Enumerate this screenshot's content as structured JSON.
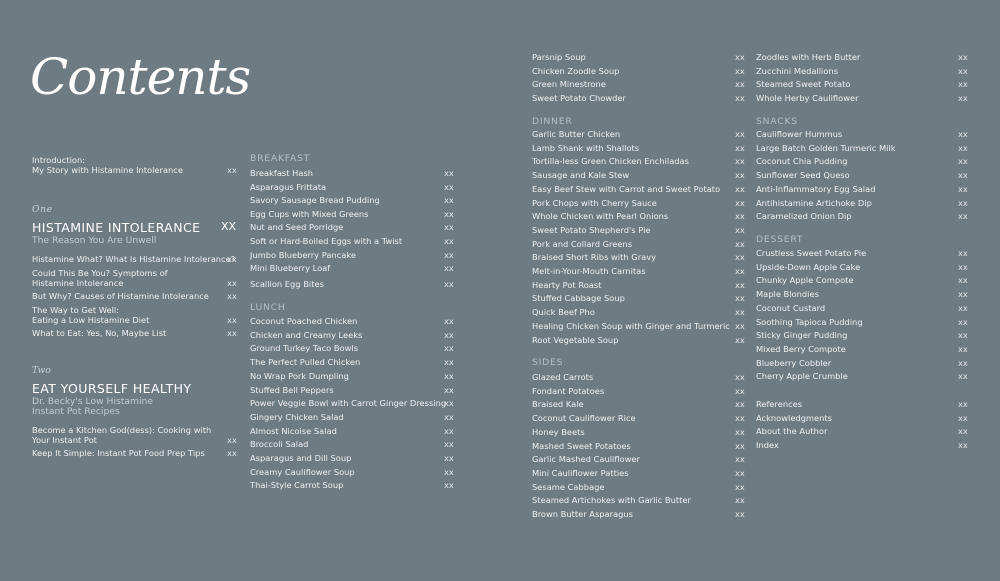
{
  "title": "Contents",
  "intro": {
    "items": [
      {
        "label": "Introduction:\nMy Story with Histamine Intolerance",
        "page": "xx"
      }
    ]
  },
  "part_one": {
    "number": "One",
    "title": "HISTAMINE INTOLERANCE",
    "page": "XX",
    "subtitle": "The Reason You Are Unwell",
    "items": [
      {
        "label": "Histamine What? What Is Histamine Intolerance?",
        "page": "xx"
      },
      {
        "label": "Could This Be You? Symptoms of\nHistamine Intolerance",
        "page": "xx"
      },
      {
        "label": "But Why? Causes of Histamine Intolerance",
        "page": "xx"
      },
      {
        "label": "The Way to Get Well:\nEating a Low Histamine Diet",
        "page": "xx"
      },
      {
        "label": "What to Eat: Yes, No, Maybe List",
        "page": "xx"
      }
    ]
  },
  "part_two": {
    "number": "Two",
    "title": "EAT YOURSELF HEALTHY",
    "subtitle": "Dr. Becky's Low Histamine\nInstant Pot Recipes",
    "items": [
      {
        "label": "Become a Kitchen God(dess): Cooking with\nYour Instant Pot",
        "page": "xx"
      },
      {
        "label": "Keep It Simple: Instant Pot Food Prep Tips",
        "page": "xx"
      }
    ]
  },
  "breakfast": {
    "heading": "BREAKFAST",
    "items": [
      {
        "label": "Breakfast Hash",
        "page": "xx"
      },
      {
        "label": "Asparagus Frittata",
        "page": "xx"
      },
      {
        "label": "Savory Sausage Bread Pudding",
        "page": "xx"
      },
      {
        "label": "Egg Cups with Mixed Greens",
        "page": "xx"
      },
      {
        "label": "Nut and Seed Porridge",
        "page": "xx"
      },
      {
        "label": "Soft or Hard-Boiled Eggs with a Twist",
        "page": "xx"
      },
      {
        "label": "Jumbo Blueberry Pancake",
        "page": "xx"
      },
      {
        "label": "Mini Blueberry Loaf",
        "page": "xx"
      },
      {
        "label": "Scallion Egg Bites",
        "page": "xx"
      }
    ]
  },
  "lunch": {
    "heading": "LUNCH",
    "items": [
      {
        "label": "Coconut Poached Chicken",
        "page": "xx"
      },
      {
        "label": "Chicken and Creamy Leeks",
        "page": "xx"
      },
      {
        "label": "Ground Turkey Taco Bowls",
        "page": "xx"
      },
      {
        "label": "The Perfect Pulled Chicken",
        "page": "xx"
      },
      {
        "label": "No Wrap Pork Dumpling",
        "page": "xx"
      },
      {
        "label": "Stuffed Bell Peppers",
        "page": "xx"
      },
      {
        "label": "Power Veggie Bowl with Carrot Ginger Dressing",
        "page": "xx"
      },
      {
        "label": "Gingery Chicken Salad",
        "page": "xx"
      },
      {
        "label": "Almost Nicoise Salad",
        "page": "xx"
      },
      {
        "label": "Broccoli Salad",
        "page": "xx"
      },
      {
        "label": "Asparagus and Dill Soup",
        "page": "xx"
      },
      {
        "label": "Creamy Cauliflower Soup",
        "page": "xx"
      },
      {
        "label": "Thai-Style Carrot Soup",
        "page": "xx"
      }
    ]
  },
  "soups_cont": {
    "items": [
      {
        "label": "Parsnip Soup",
        "page": "xx"
      },
      {
        "label": "Chicken Zoodle Soup",
        "page": "xx"
      },
      {
        "label": "Green Minestrone",
        "page": "xx"
      },
      {
        "label": "Sweet Potato Chowder",
        "page": "xx"
      }
    ]
  },
  "dinner": {
    "heading": "DINNER",
    "items": [
      {
        "label": "Garlic Butter Chicken",
        "page": "xx"
      },
      {
        "label": "Lamb Shank with Shallots",
        "page": "xx"
      },
      {
        "label": "Tortilla-less Green Chicken Enchiladas",
        "page": "xx"
      },
      {
        "label": "Sausage and Kale Stew",
        "page": "xx"
      },
      {
        "label": "Easy Beef Stew with Carrot and Sweet Potato",
        "page": "xx"
      },
      {
        "label": "Pork Chops with Cherry Sauce",
        "page": "xx"
      },
      {
        "label": "Whole Chicken with Pearl Onions",
        "page": "xx"
      },
      {
        "label": "Sweet Potato Shepherd's Pie",
        "page": "xx"
      },
      {
        "label": "Pork and Collard Greens",
        "page": "xx"
      },
      {
        "label": "Braised Short Ribs with Gravy",
        "page": "xx"
      },
      {
        "label": "Melt-in-Your-Mouth Carnitas",
        "page": "xx"
      },
      {
        "label": "Hearty Pot Roast",
        "page": "xx"
      },
      {
        "label": "Stuffed Cabbage Soup",
        "page": "xx"
      },
      {
        "label": "Quick Beef Pho",
        "page": "xx"
      },
      {
        "label": "Healing Chicken Soup with Ginger and Turmeric",
        "page": "xx"
      },
      {
        "label": "Root Vegetable Soup",
        "page": "xx"
      }
    ]
  },
  "sides": {
    "heading": "SIDES",
    "items": [
      {
        "label": "Glazed Carrots",
        "page": "xx"
      },
      {
        "label": "Fondant Potatoes",
        "page": "xx"
      },
      {
        "label": "Braised Kale",
        "page": "xx"
      },
      {
        "label": "Coconut Cauliflower Rice",
        "page": "xx"
      },
      {
        "label": "Honey Beets",
        "page": "xx"
      },
      {
        "label": "Mashed Sweet Potatoes",
        "page": "xx"
      },
      {
        "label": "Garlic Mashed Cauliflower",
        "page": "xx"
      },
      {
        "label": "Mini Cauliflower Patties",
        "page": "xx"
      },
      {
        "label": "Sesame Cabbage",
        "page": "xx"
      },
      {
        "label": "Steamed Artichokes with Garlic Butter",
        "page": "xx"
      },
      {
        "label": "Brown Butter Asparagus",
        "page": "xx"
      }
    ]
  },
  "sides_cont": {
    "items": [
      {
        "label": "Zoodles with Herb Butter",
        "page": "xx"
      },
      {
        "label": "Zucchini Medallions",
        "page": "xx"
      },
      {
        "label": "Steamed Sweet Potato",
        "page": "xx"
      },
      {
        "label": "Whole Herby Cauliflower",
        "page": "xx"
      }
    ]
  },
  "snacks": {
    "heading": "SNACKS",
    "items": [
      {
        "label": "Cauliflower Hummus",
        "page": "xx"
      },
      {
        "label": "Large Batch Golden Turmeric Milk",
        "page": "xx"
      },
      {
        "label": "Coconut Chia Pudding",
        "page": "xx"
      },
      {
        "label": "Sunflower Seed Queso",
        "page": "xx"
      },
      {
        "label": "Anti-Inflammatory Egg Salad",
        "page": "xx"
      },
      {
        "label": "Antihistamine Artichoke Dip",
        "page": "xx"
      },
      {
        "label": "Caramelized Onion Dip",
        "page": "xx"
      }
    ]
  },
  "dessert": {
    "heading": "DESSERT",
    "items": [
      {
        "label": "Crustless Sweet Potato Pie",
        "page": "xx"
      },
      {
        "label": "Upside-Down Apple Cake",
        "page": "xx"
      },
      {
        "label": "Chunky Apple Compote",
        "page": "xx"
      },
      {
        "label": "Maple Blondies",
        "page": "xx"
      },
      {
        "label": "Coconut Custard",
        "page": "xx"
      },
      {
        "label": "Soothing Tapioca Pudding",
        "page": "xx"
      },
      {
        "label": "Sticky Ginger Pudding",
        "page": "xx"
      },
      {
        "label": "Mixed Berry Compote",
        "page": "xx"
      },
      {
        "label": "Blueberry Cobbler",
        "page": "xx"
      },
      {
        "label": "Cherry Apple Crumble",
        "page": "xx"
      }
    ]
  },
  "back_matter": {
    "items": [
      {
        "label": "References",
        "page": "xx"
      },
      {
        "label": "Acknowledgments",
        "page": "xx"
      },
      {
        "label": "About the Author",
        "page": "xx"
      },
      {
        "label": "Index",
        "page": "xx"
      }
    ]
  }
}
